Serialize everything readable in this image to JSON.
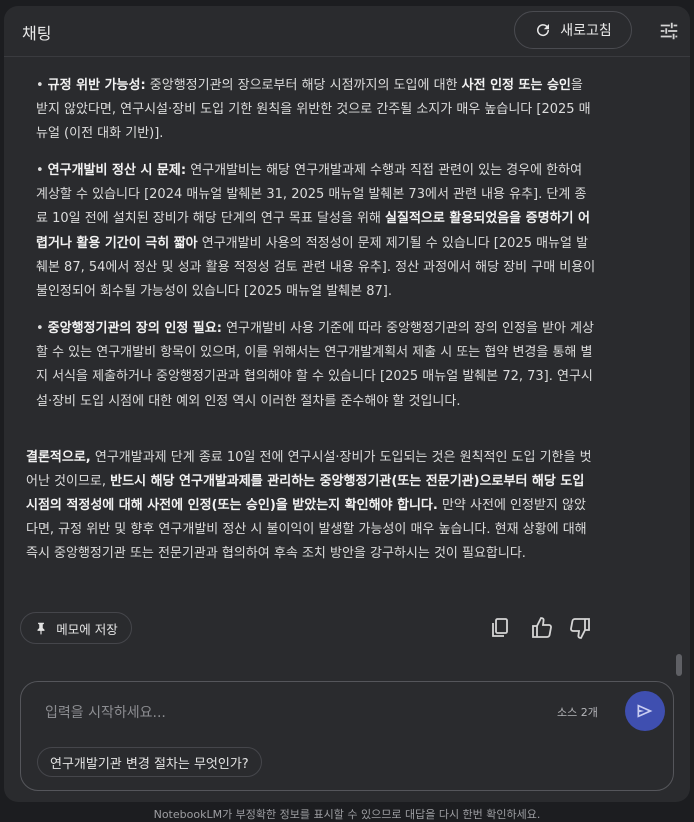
{
  "header": {
    "title": "채팅",
    "refresh_label": "새로고침"
  },
  "content": {
    "bullet1": {
      "lead": "규정 위반 가능성:",
      "t1": " 중앙행정기관의 장으로부터 해당 시점까지의 도입에 대한 ",
      "b1": "사전 인정 또는 승인",
      "t2": "을 받지 않았다면, 연구시설·장비 도입 기한 원칙을 위반한 것으로 간주될 소지가 매우 높습니다 [2025 매뉴얼 (이전 대화 기반)]."
    },
    "bullet2": {
      "lead": "연구개발비 정산 시 문제:",
      "t1": " 연구개발비는 해당 연구개발과제 수행과 직접 관련이 있는 경우에 한하여 계상할 수 있습니다 [2024 매뉴얼 발췌본 31, 2025 매뉴얼 발췌본 73에서 관련 내용 유추]. 단계 종료 10일 전에 설치된 장비가 해당 단계의 연구 목표 달성을 위해 ",
      "b1": "실질적으로 활용되었음을 증명하기 어렵거나 활용 기간이 극히 짧아",
      "t2": " 연구개발비 사용의 적정성이 문제 제기될 수 있습니다 [2025 매뉴얼 발췌본 87, 54에서 정산 및 성과 활용 적정성 검토 관련 내용 유추]. 정산 과정에서 해당 장비 구매 비용이 불인정되어 회수될 가능성이 있습니다 [2025 매뉴얼 발췌본 87]."
    },
    "bullet3": {
      "lead": "중앙행정기관의 장의 인정 필요:",
      "t1": " 연구개발비 사용 기준에 따라 중앙행정기관의 장의 인정을 받아 계상할 수 있는 연구개발비 항목이 있으며, 이를 위해서는 연구개발계획서 제출 시 또는 협약 변경을 통해 별지 서식을 제출하거나 중앙행정기관과 협의해야 할 수 있습니다 [2025 매뉴얼 발췌본 72, 73]. 연구시설·장비 도입 시점에 대한 예외 인정 역시 이러한 절차를 준수해야 할 것입니다."
    },
    "conclusion": {
      "lead": "결론적으로,",
      "t1": " 연구개발과제 단계 종료 10일 전에 연구시설·장비가 도입되는 것은 원칙적인 도입 기한을 벗어난 것이므로, ",
      "b1": "반드시 해당 연구개발과제를 관리하는 중앙행정기관(또는 전문기관)으로부터 해당 도입 시점의 적정성에 대해 사전에 인정(또는 승인)을 받았는지 확인해야 합니다.",
      "t2": " 만약 사전에 인정받지 않았다면, 규정 위반 및 향후 연구개발비 정산 시 불이익이 발생할 가능성이 매우 높습니다. 현재 상황에 대해 즉시 중앙행정기관 또는 전문기관과 협의하여 후속 조치 방안을 강구하시는 것이 필요합니다."
    }
  },
  "actions": {
    "memo_label": "메모에 저장"
  },
  "input": {
    "placeholder": "입력을 시작하세요...",
    "source_count": "소스 2개"
  },
  "suggestion": "연구개발기관 변경 절차는 무엇인가?",
  "disclaimer": "NotebookLM가 부정확한 정보를 표시할 수 있으므로 대답을 다시 한번 확인하세요.",
  "colors": {
    "accent": "#3f4fb0",
    "background": "#2a2b2e"
  }
}
